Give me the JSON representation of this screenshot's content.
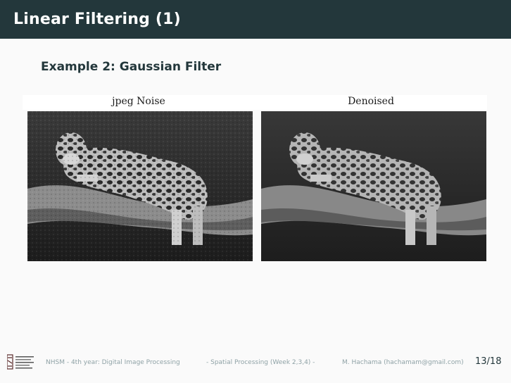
{
  "slide": {
    "title": "Linear Filtering (1)",
    "example_heading": "Example 2: Gaussian Filter"
  },
  "figure": {
    "panels": [
      {
        "caption": "jpeg Noise"
      },
      {
        "caption": "Denoised"
      }
    ]
  },
  "footer": {
    "course": "NHSM - 4th year: Digital Image Processing",
    "section": "- Spatial Processing (Week 2,3,4) -",
    "author": "M. Hachama (hachamam@gmail.com)",
    "page": "13/18"
  },
  "colors": {
    "title_bar": "#23373b",
    "footer_text": "#8fa2a6"
  }
}
